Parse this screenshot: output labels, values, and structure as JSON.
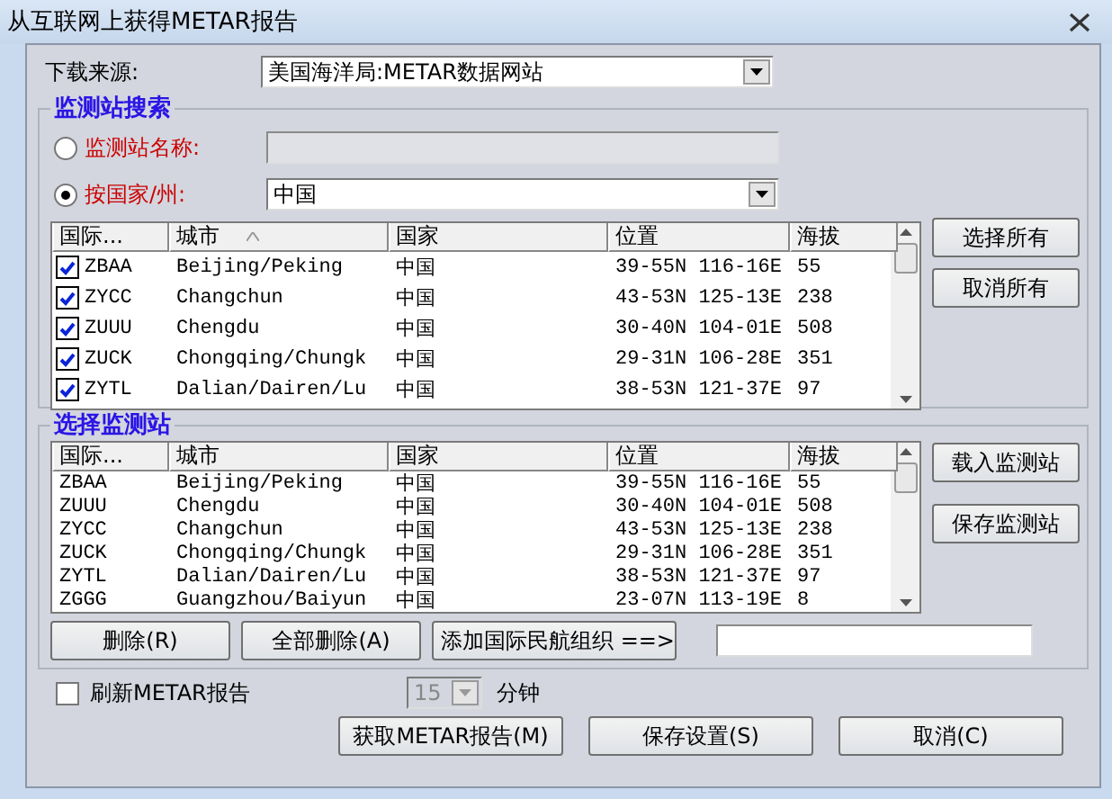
{
  "window": {
    "title": "从互联网上获得METAR报告"
  },
  "source": {
    "label": "下载来源:",
    "value": "美国海洋局:METAR数据网站"
  },
  "search_group": {
    "title": "监测站搜索",
    "options": [
      {
        "kind": "text",
        "label": "监测站名称:",
        "selected": false
      },
      {
        "kind": "combo",
        "label": "按国家/州:",
        "selected": true,
        "value": "中国"
      }
    ],
    "table": {
      "columns": [
        {
          "label": "国际...",
          "sorted": false
        },
        {
          "label": "城市",
          "sorted": true
        },
        {
          "label": "国家",
          "sorted": false
        },
        {
          "label": "位置",
          "sorted": false
        },
        {
          "label": "海拔",
          "sorted": false
        }
      ],
      "rows": [
        {
          "checked": true,
          "cells": [
            "ZBAA",
            "Beijing/Peking",
            "中国",
            "39-55N 116-16E",
            "55"
          ]
        },
        {
          "checked": true,
          "cells": [
            "ZYCC",
            "Changchun",
            "中国",
            "43-53N 125-13E",
            "238"
          ]
        },
        {
          "checked": true,
          "cells": [
            "ZUUU",
            "Chengdu",
            "中国",
            "30-40N 104-01E",
            "508"
          ]
        },
        {
          "checked": true,
          "cells": [
            "ZUCK",
            "Chongqing/Chungk",
            "中国",
            "29-31N 106-28E",
            "351"
          ]
        },
        {
          "checked": true,
          "cells": [
            "ZYTL",
            "Dalian/Dairen/Lu",
            "中国",
            "38-53N 121-37E",
            "97"
          ]
        }
      ]
    },
    "side_buttons": [
      "选择所有",
      "取消所有"
    ]
  },
  "selected_group": {
    "title": "选择监测站",
    "table": {
      "columns": [
        {
          "label": "国际...",
          "sorted": false
        },
        {
          "label": "城市",
          "sorted": false
        },
        {
          "label": "国家",
          "sorted": false
        },
        {
          "label": "位置",
          "sorted": false
        },
        {
          "label": "海拔",
          "sorted": false
        }
      ],
      "rows": [
        {
          "cells": [
            "ZBAA",
            "Beijing/Peking",
            "中国",
            "39-55N 116-16E",
            "55"
          ]
        },
        {
          "cells": [
            "ZUUU",
            "Chengdu",
            "中国",
            "30-40N 104-01E",
            "508"
          ]
        },
        {
          "cells": [
            "ZYCC",
            "Changchun",
            "中国",
            "43-53N 125-13E",
            "238"
          ]
        },
        {
          "cells": [
            "ZUCK",
            "Chongqing/Chungk",
            "中国",
            "29-31N 106-28E",
            "351"
          ]
        },
        {
          "cells": [
            "ZYTL",
            "Dalian/Dairen/Lu",
            "中国",
            "38-53N 121-37E",
            "97"
          ]
        },
        {
          "cells": [
            "ZGGG",
            "Guangzhou/Baiyun",
            "中国",
            "23-07N 113-19E",
            "8"
          ]
        }
      ]
    },
    "side_buttons": [
      "载入监测站",
      "保存监测站"
    ],
    "buttons": [
      "删除(R)",
      "全部删除(A)",
      "添加国际民航组织 ==>"
    ]
  },
  "refresh": {
    "label": "刷新METAR报告",
    "checked": false,
    "interval": "15",
    "interval_disabled": true,
    "unit": "分钟"
  },
  "footer_buttons": [
    "获取METAR报告(M)",
    "保存设置(S)",
    "取消(C)"
  ]
}
